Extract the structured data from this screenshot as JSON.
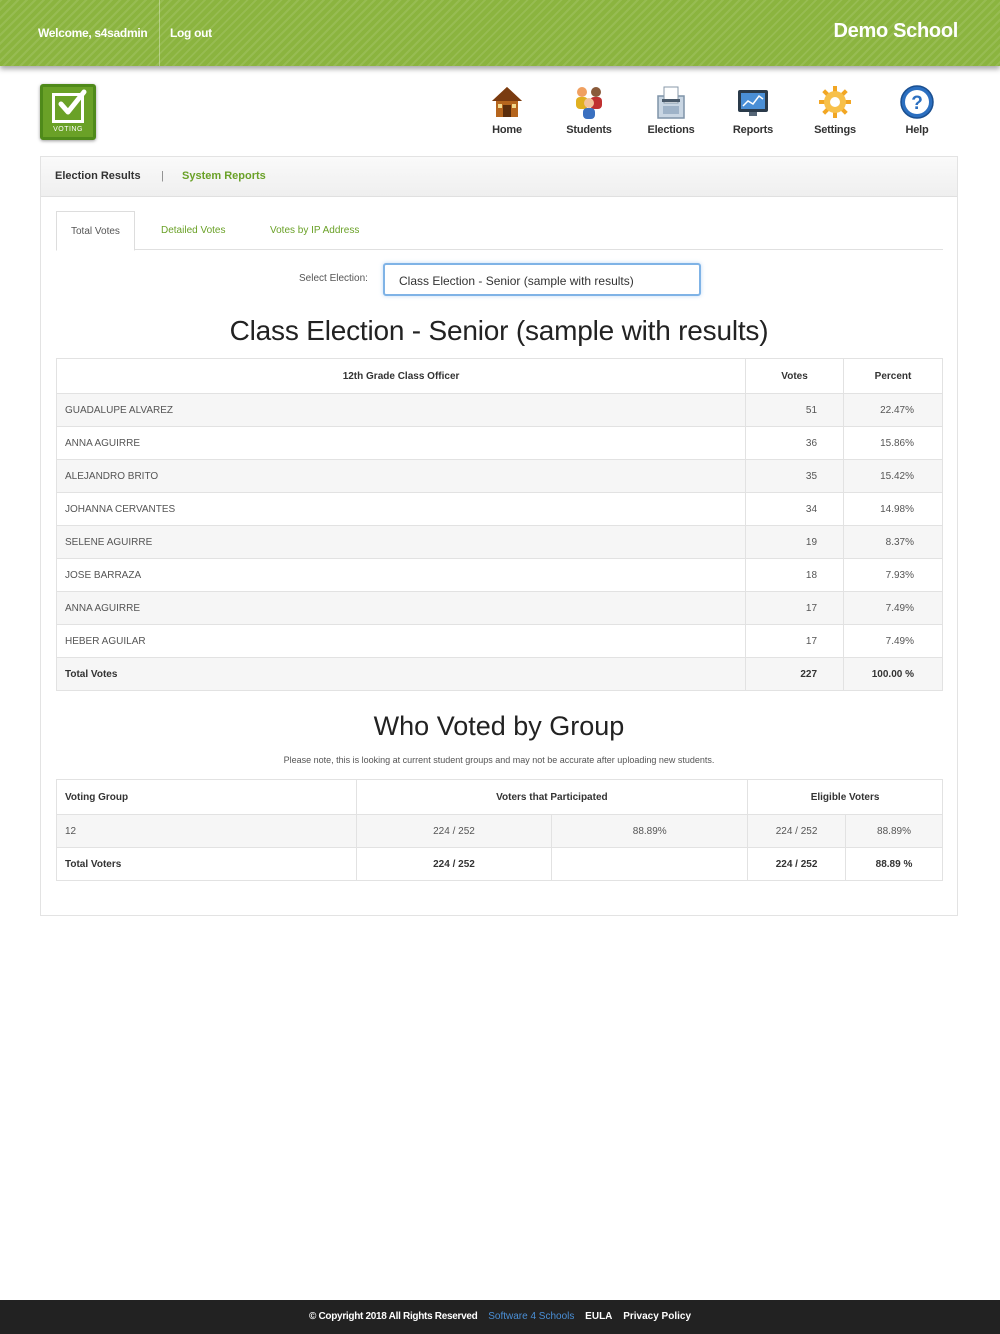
{
  "topbar": {
    "welcome": "Welcome, s4sadmin",
    "logout": "Log out",
    "school": "Demo School"
  },
  "logo": {
    "caption": "VOTING"
  },
  "nav": [
    {
      "label": "Home",
      "icon": "house-icon"
    },
    {
      "label": "Students",
      "icon": "students-icon"
    },
    {
      "label": "Elections",
      "icon": "ballot-box-icon"
    },
    {
      "label": "Reports",
      "icon": "monitor-icon"
    },
    {
      "label": "Settings",
      "icon": "gear-icon"
    },
    {
      "label": "Help",
      "icon": "help-icon"
    }
  ],
  "subnav": {
    "current": "Election Results",
    "separator": "|",
    "link": "System Reports"
  },
  "tabs": [
    "Total Votes",
    "Detailed Votes",
    "Votes by IP Address"
  ],
  "select": {
    "label": "Select Election:",
    "value": "Class Election - Senior (sample with results)"
  },
  "election_title": "Class Election - Senior (sample with results)",
  "results": {
    "headers": [
      "12th Grade Class Officer",
      "Votes",
      "Percent"
    ],
    "rows": [
      {
        "name": "GUADALUPE ALVAREZ",
        "votes": "51",
        "pct": "22.47%"
      },
      {
        "name": "ANNA AGUIRRE",
        "votes": "36",
        "pct": "15.86%"
      },
      {
        "name": "ALEJANDRO BRITO",
        "votes": "35",
        "pct": "15.42%"
      },
      {
        "name": "JOHANNA CERVANTES",
        "votes": "34",
        "pct": "14.98%"
      },
      {
        "name": "SELENE AGUIRRE",
        "votes": "19",
        "pct": "8.37%"
      },
      {
        "name": "JOSE BARRAZA",
        "votes": "18",
        "pct": "7.93%"
      },
      {
        "name": "ANNA AGUIRRE",
        "votes": "17",
        "pct": "7.49%"
      },
      {
        "name": "HEBER AGUILAR",
        "votes": "17",
        "pct": "7.49%"
      }
    ],
    "total": {
      "label": "Total Votes",
      "votes": "227",
      "pct": "100.00 %"
    }
  },
  "groups_title": "Who Voted by Group",
  "groups_note": "Please note, this is looking at current student groups and may not be accurate after uploading new students.",
  "groups": {
    "headers": [
      "Voting Group",
      "Voters that Participated",
      "Eligible Voters"
    ],
    "rows": [
      {
        "group": "12",
        "participated": "224 / 252",
        "participated_pct": "88.89%",
        "eligible": "224 / 252",
        "eligible_pct": "88.89%"
      }
    ],
    "total": {
      "label": "Total Voters",
      "participated": "224 / 252",
      "participated_pct": "",
      "eligible": "224 / 252",
      "eligible_pct": "88.89 %"
    }
  },
  "footer": {
    "copyright": "© Copyright 2018 All Rights Reserved",
    "company": "Software 4 Schools",
    "eula": "EULA",
    "privacy": "Privacy Policy"
  }
}
